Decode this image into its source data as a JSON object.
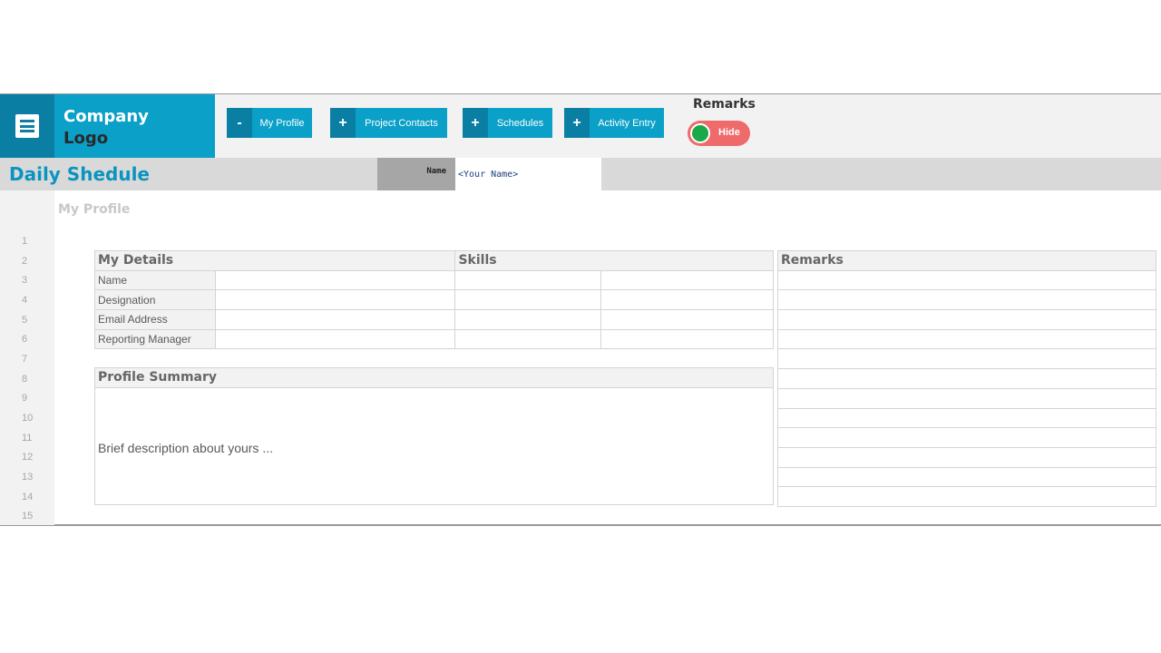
{
  "brand": {
    "name_line1": "Company",
    "name_line2": "Logo",
    "colors": {
      "accent": "#0aa0c8",
      "accent_dark": "#0b7fa3",
      "toggle_bg": "#ef6b6b",
      "toggle_knob": "#1aa84a"
    }
  },
  "menu": {
    "icon": "hamburger-menu-icon"
  },
  "nav": {
    "my_profile": {
      "sign": "-",
      "label": "My Profile"
    },
    "project_contacts": {
      "sign": "+",
      "label": "Project Contacts"
    },
    "schedules": {
      "sign": "+",
      "label": "Schedules"
    },
    "activity_entry": {
      "sign": "+",
      "label": "Activity Entry"
    }
  },
  "remarks_toggle": {
    "title": "Remarks",
    "label": "Hide",
    "state": "on"
  },
  "header": {
    "title": "Daily Shedule",
    "name_label": "Name",
    "name_value": "<Your Name>"
  },
  "sheet": {
    "section_title": "My Profile",
    "row_numbers": [
      "1",
      "2",
      "3",
      "4",
      "5",
      "6",
      "7",
      "8",
      "9",
      "10",
      "11",
      "12",
      "13",
      "14",
      "15"
    ],
    "details": {
      "title": "My Details",
      "fields": [
        "Name",
        "Designation",
        "Email Address",
        "Reporting Manager"
      ]
    },
    "skills": {
      "title": "Skills"
    },
    "remarks": {
      "title": "Remarks"
    },
    "summary": {
      "title": "Profile Summary",
      "text": "Brief description about yours ..."
    }
  }
}
